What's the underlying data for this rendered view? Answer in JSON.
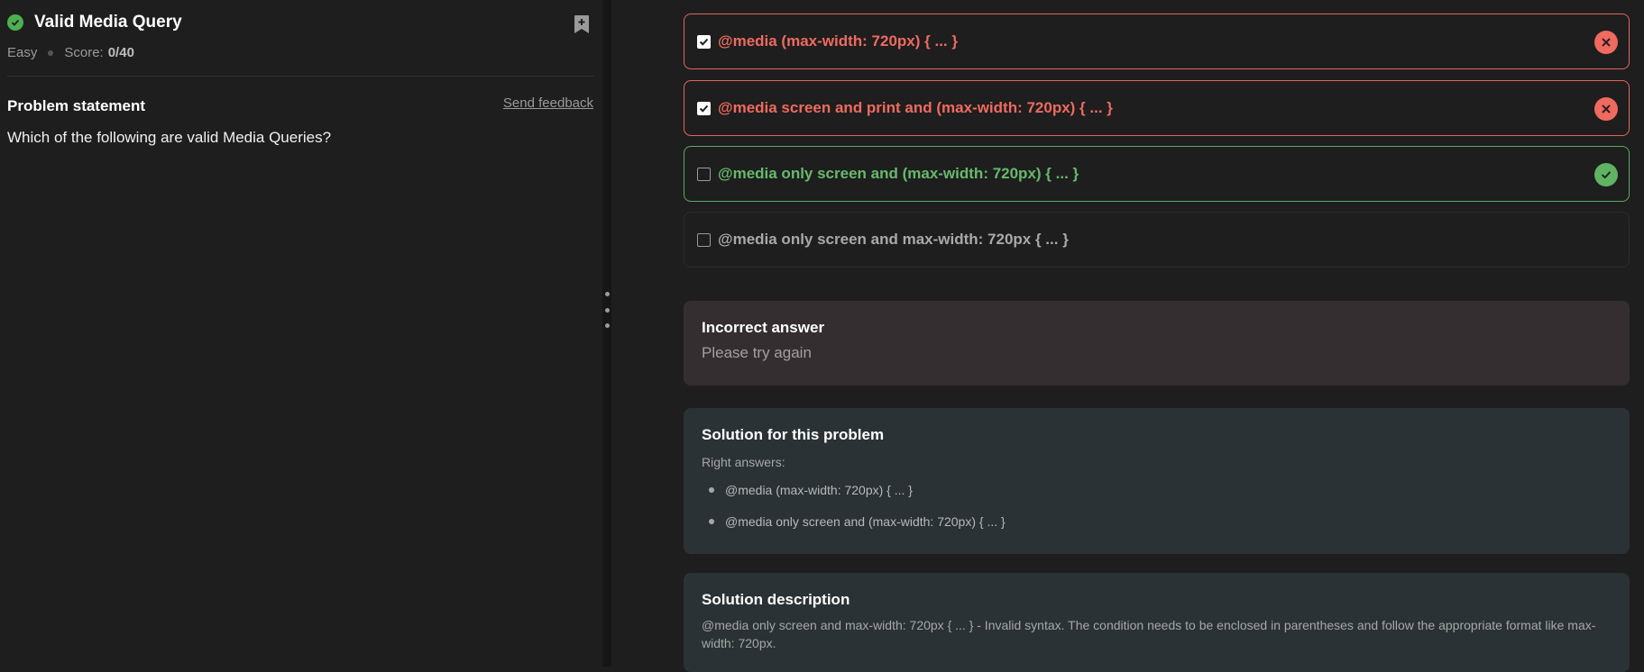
{
  "problem": {
    "title": "Valid Media Query",
    "difficulty": "Easy",
    "score_label": "Score:",
    "score_value": "0/40",
    "section_label": "Problem statement",
    "feedback_label": "Send feedback",
    "statement": "Which of the following are valid Media Queries?"
  },
  "options": [
    {
      "text": "@media (max-width: 720px) { ... }",
      "checked": true,
      "status": "wrong"
    },
    {
      "text": "@media screen and print and (max-width: 720px) { ... }",
      "checked": true,
      "status": "wrong"
    },
    {
      "text": "@media only screen and (max-width: 720px) { ... }",
      "checked": false,
      "status": "correct"
    },
    {
      "text": "@media only screen and max-width: 720px { ... }",
      "checked": false,
      "status": "neutral"
    }
  ],
  "result": {
    "title": "Incorrect answer",
    "message": "Please try again"
  },
  "solution": {
    "title": "Solution for this problem",
    "subtitle": "Right answers:",
    "answers": [
      "@media (max-width: 720px) { ... }",
      "@media only screen and (max-width: 720px) { ... }"
    ]
  },
  "description": {
    "title": "Solution description",
    "text": "@media only screen and max-width: 720px { ... } - Invalid syntax. The condition needs to be enclosed in parentheses and follow the appropriate format like max-width: 720px."
  },
  "colors": {
    "wrong": "#ef6a5f",
    "correct": "#5fb363",
    "background": "#1e1e1e"
  }
}
